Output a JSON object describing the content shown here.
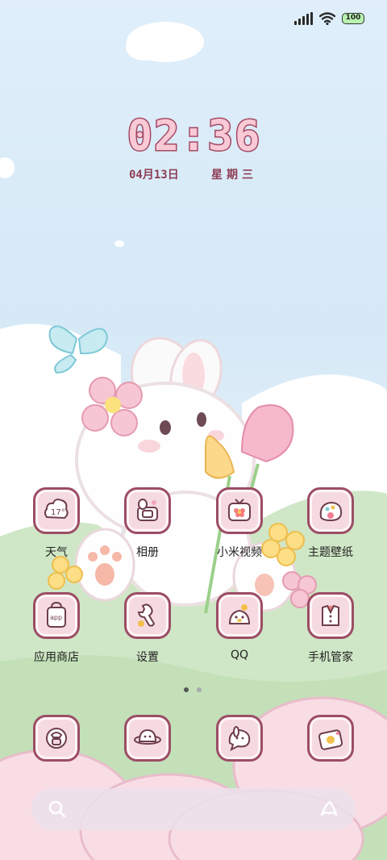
{
  "status_bar": {
    "signal_icon": "signal-bars-icon",
    "wifi_icon": "wifi-icon",
    "battery_level": "100"
  },
  "lockclock": {
    "time": "02:36",
    "date": "04月13日",
    "weekday": "星期三"
  },
  "apps": [
    {
      "label": "天气",
      "icon": "weather-bunny-icon"
    },
    {
      "label": "相册",
      "icon": "gallery-camera-icon"
    },
    {
      "label": "小米视频",
      "icon": "video-tv-icon"
    },
    {
      "label": "主题壁纸",
      "icon": "theme-palette-icon"
    },
    {
      "label": "应用商店",
      "icon": "app-store-bag-icon"
    },
    {
      "label": "设置",
      "icon": "settings-wrench-icon"
    },
    {
      "label": "QQ",
      "icon": "qq-penguin-icon"
    },
    {
      "label": "手机管家",
      "icon": "security-shirt-icon"
    }
  ],
  "page_indicator": {
    "pages": 2,
    "current": 1
  },
  "dock": [
    {
      "icon": "phone-icon"
    },
    {
      "icon": "contacts-planet-icon"
    },
    {
      "icon": "messages-bubble-icon"
    },
    {
      "icon": "camera-icon"
    }
  ],
  "search_bar": {
    "search_icon": "search-icon",
    "assistant_icon": "assistant-icon"
  },
  "colors": {
    "sky": "#dfeefa",
    "icon_border": "#9c4d65",
    "icon_fill": "#f6dae2",
    "clock_fill": "#f9c9d6",
    "clock_stroke": "#a34a63",
    "hills": "#c9e4bf"
  }
}
